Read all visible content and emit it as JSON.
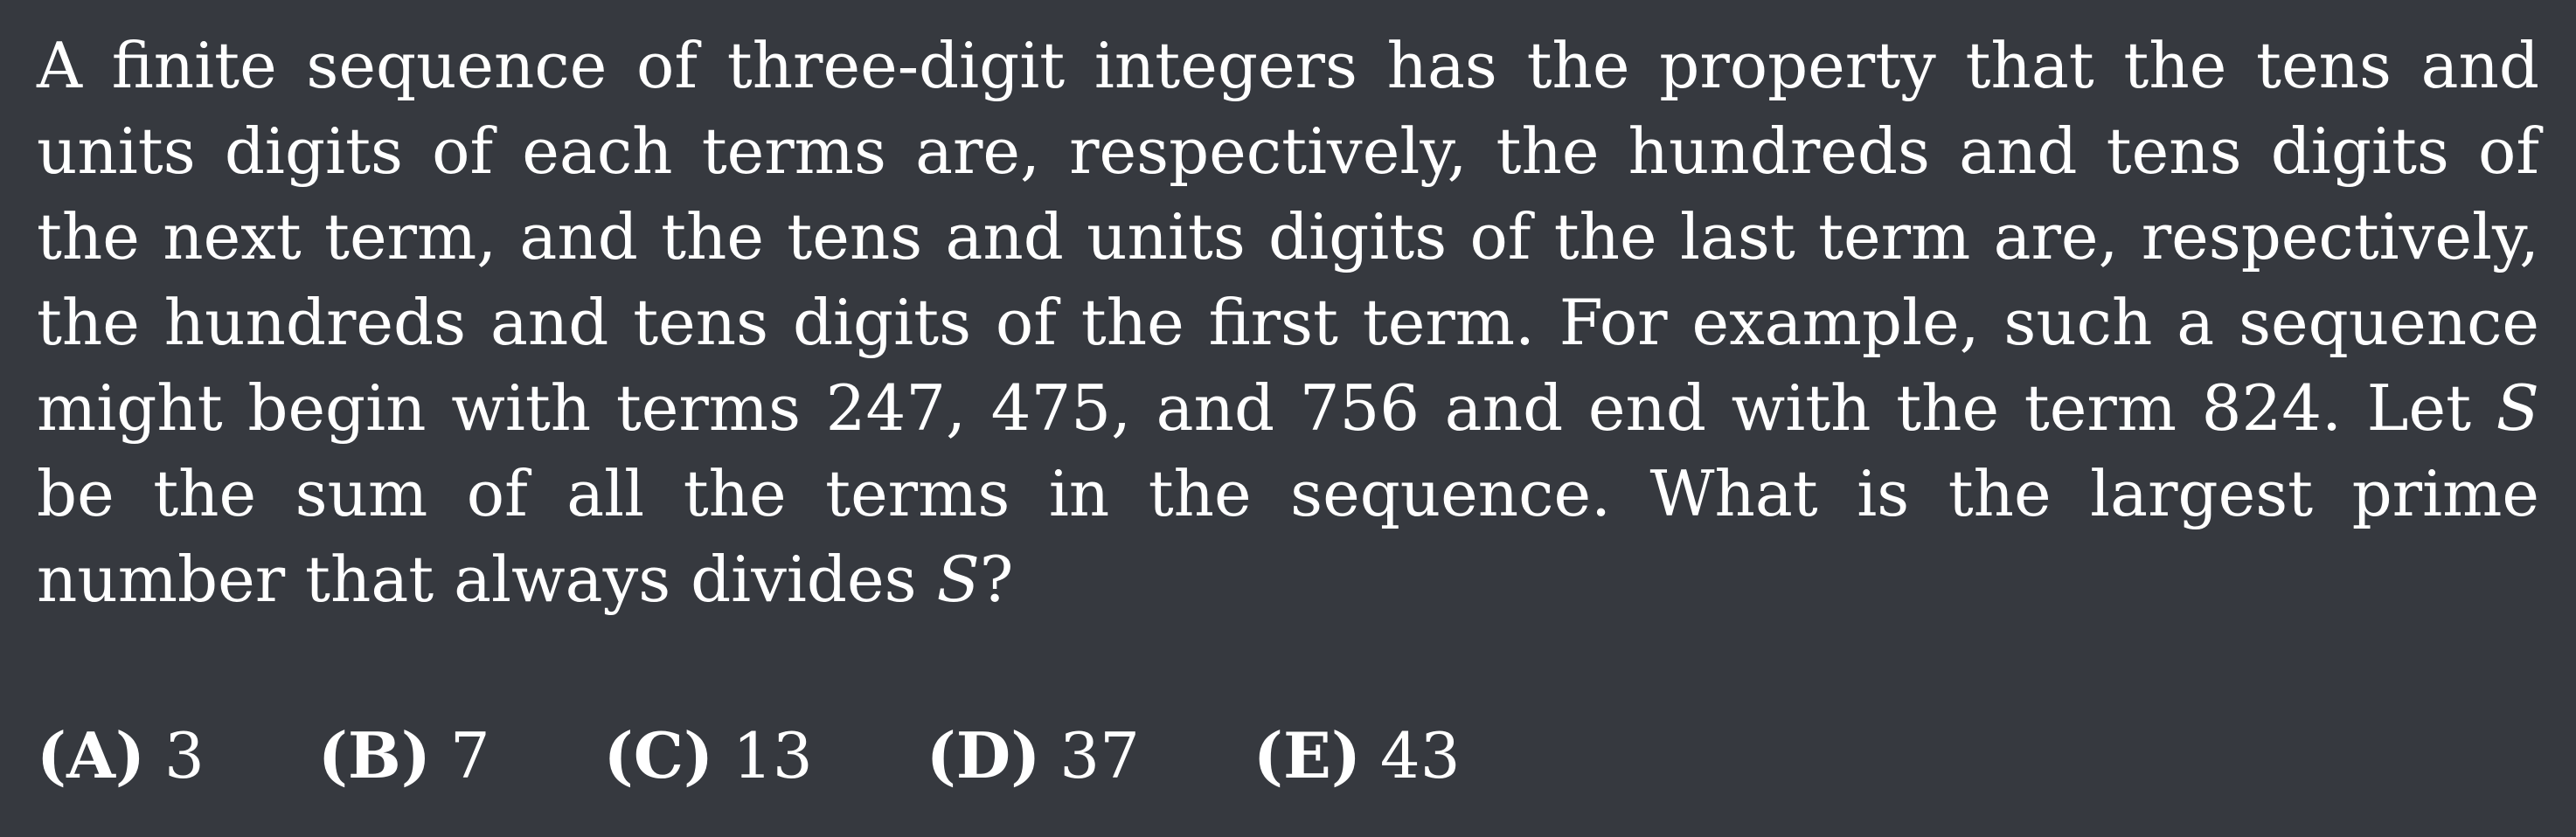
{
  "problem": {
    "text_part_1": "A finite sequence of three-digit integers has the property that the tens and units digits of each terms are, respectively, the hundreds and tens digits of the next term, and the tens and units digits of the last term are, respectively, the hundreds and tens digits of the first term. For example, such a sequence might begin with terms 247, 475, and 756 and end with the term 824. Let ",
    "var_1": "S",
    "text_part_2": " be the sum of all the terms in the sequence. What is the largest prime number that always divides ",
    "var_2": "S",
    "text_part_3": "?"
  },
  "choices": [
    {
      "letter": "(A)",
      "value": "3"
    },
    {
      "letter": "(B)",
      "value": "7"
    },
    {
      "letter": "(C)",
      "value": "13"
    },
    {
      "letter": "(D)",
      "value": "37"
    },
    {
      "letter": "(E)",
      "value": "43"
    }
  ]
}
